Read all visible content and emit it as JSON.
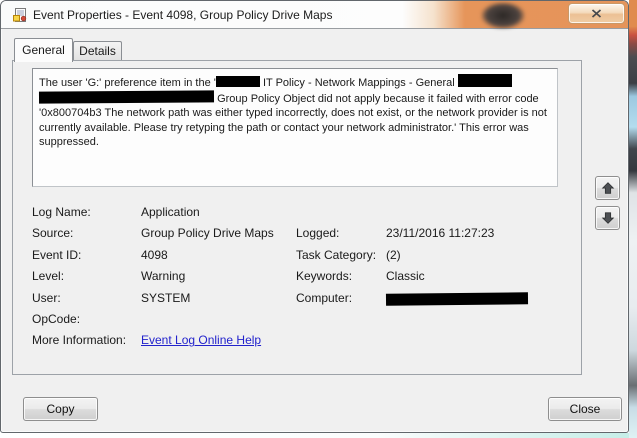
{
  "window": {
    "title": "Event Properties - Event 4098, Group Policy Drive Maps"
  },
  "icons": {
    "app": "event-properties-icon",
    "close": "close-x-icon",
    "scroll_up": "arrow-up-icon",
    "scroll_down": "arrow-down-icon"
  },
  "tabs": [
    {
      "label": "General"
    },
    {
      "label": "Details"
    }
  ],
  "description": {
    "segments": [
      {
        "type": "text",
        "text": "The user 'G:' preference item in the '"
      },
      {
        "type": "redaction"
      },
      {
        "type": "text",
        "text": " IT Policy - Network Mappings - General "
      },
      {
        "type": "redaction"
      },
      {
        "type": "redaction"
      },
      {
        "type": "text",
        "text": "Group Policy Object did not apply because it failed with error code '0x800704b3 The network path was either typed incorrectly, does not exist, or the network provider is not currently available. Please try retyping the path or contact your network administrator.' This error was suppressed."
      }
    ]
  },
  "details": {
    "rows": [
      {
        "l1": "Log Name:",
        "v1": "Application",
        "l2": "",
        "v2": ""
      },
      {
        "l1": "Source:",
        "v1": "Group Policy Drive Maps",
        "l2": "Logged:",
        "v2": "23/11/2016 11:27:23"
      },
      {
        "l1": "Event ID:",
        "v1": "4098",
        "l2": "Task Category:",
        "v2": "(2)"
      },
      {
        "l1": "Level:",
        "v1": "Warning",
        "l2": "Keywords:",
        "v2": "Classic"
      },
      {
        "l1": "User:",
        "v1": "SYSTEM",
        "l2": "Computer:",
        "v2": ""
      },
      {
        "l1": "OpCode:",
        "v1": "",
        "l2": "",
        "v2": ""
      },
      {
        "l1": "More Information:",
        "v1": "",
        "l2": "",
        "v2": ""
      }
    ],
    "more_info_link": "Event Log Online Help"
  },
  "buttons": {
    "copy": "Copy",
    "close": "Close"
  },
  "colors": {
    "accent_orange": "#e6955a",
    "link_blue": "#2222cc",
    "dialog_bg": "#f0f0f0",
    "redaction": "#000000"
  }
}
